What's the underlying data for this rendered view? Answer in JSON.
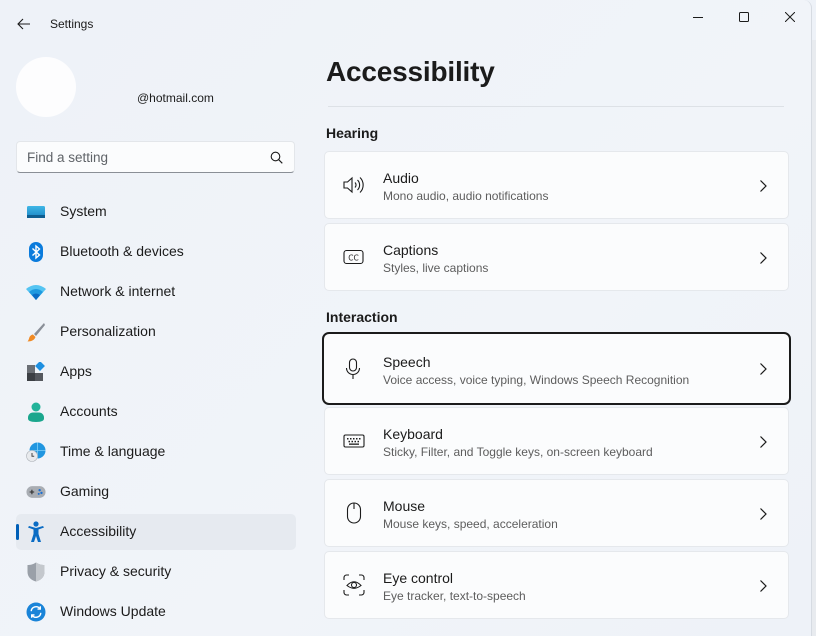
{
  "window": {
    "app_title": "Settings",
    "controls": {
      "minimize": "minimize-icon",
      "maximize": "maximize-icon",
      "close": "close-icon"
    }
  },
  "profile": {
    "email": "@hotmail.com"
  },
  "search": {
    "placeholder": "Find a setting",
    "value": ""
  },
  "sidebar": {
    "items": [
      {
        "label": "System",
        "icon": "system-icon",
        "selected": false
      },
      {
        "label": "Bluetooth & devices",
        "icon": "bluetooth-icon",
        "selected": false
      },
      {
        "label": "Network & internet",
        "icon": "wifi-icon",
        "selected": false
      },
      {
        "label": "Personalization",
        "icon": "paintbrush-icon",
        "selected": false
      },
      {
        "label": "Apps",
        "icon": "apps-icon",
        "selected": false
      },
      {
        "label": "Accounts",
        "icon": "person-icon",
        "selected": false
      },
      {
        "label": "Time & language",
        "icon": "globe-clock-icon",
        "selected": false
      },
      {
        "label": "Gaming",
        "icon": "gamepad-icon",
        "selected": false
      },
      {
        "label": "Accessibility",
        "icon": "accessibility-icon",
        "selected": true
      },
      {
        "label": "Privacy & security",
        "icon": "shield-icon",
        "selected": false
      },
      {
        "label": "Windows Update",
        "icon": "update-icon",
        "selected": false
      }
    ]
  },
  "main": {
    "title": "Accessibility",
    "sections": [
      {
        "heading": "Hearing",
        "cards": [
          {
            "title": "Audio",
            "subtitle": "Mono audio, audio notifications",
            "icon": "speaker-icon"
          },
          {
            "title": "Captions",
            "subtitle": "Styles, live captions",
            "icon": "closed-captions-icon"
          }
        ]
      },
      {
        "heading": "Interaction",
        "cards": [
          {
            "title": "Speech",
            "subtitle": "Voice access, voice typing, Windows Speech Recognition",
            "icon": "microphone-icon",
            "focused": true
          },
          {
            "title": "Keyboard",
            "subtitle": "Sticky, Filter, and Toggle keys, on-screen keyboard",
            "icon": "keyboard-icon"
          },
          {
            "title": "Mouse",
            "subtitle": "Mouse keys, speed, acceleration",
            "icon": "mouse-icon"
          },
          {
            "title": "Eye control",
            "subtitle": "Eye tracker, text-to-speech",
            "icon": "eye-control-icon"
          }
        ]
      }
    ]
  },
  "colors": {
    "accent": "#005fb8",
    "background": "#eef2f8",
    "card": "#fbfcfd",
    "selected_nav": "#e6eaf0"
  }
}
